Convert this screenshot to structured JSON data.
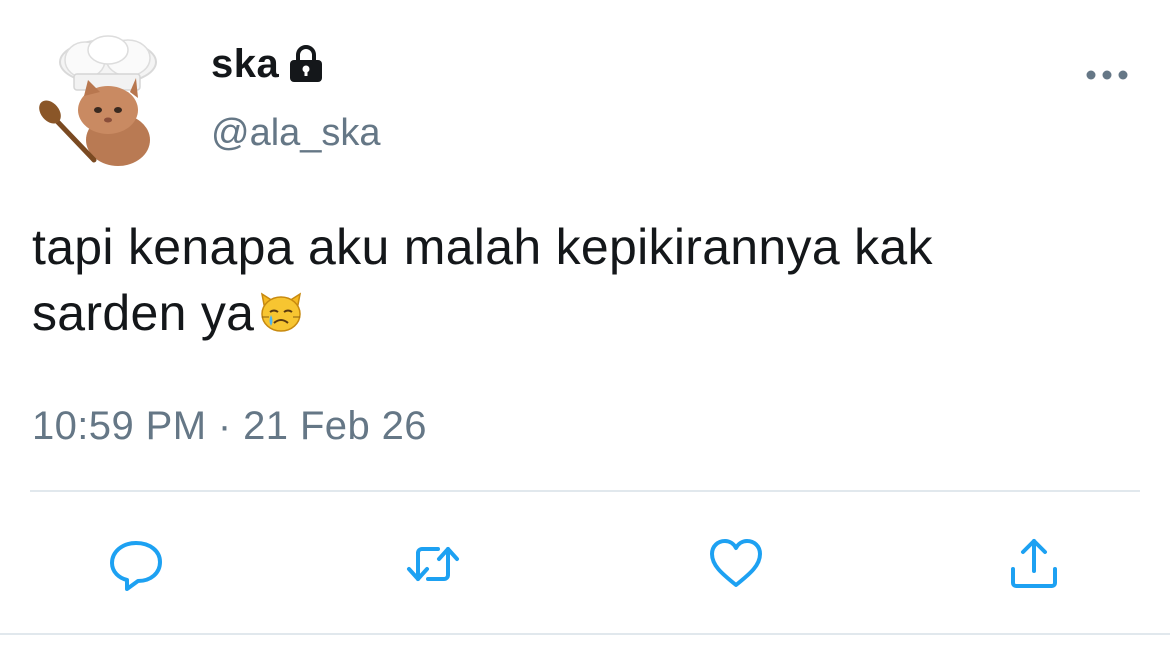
{
  "tweet": {
    "author": {
      "display_name": "ska",
      "handle": "@ala_ska",
      "protected_icon": "lock-icon",
      "avatar": "chef-cat-avatar"
    },
    "text_line1": "tapi kenapa aku malah kepikirannya kak",
    "text_line2": "sarden ya",
    "emoji": "crying-cat-face-emoji",
    "timestamp": "10:59 PM · 21 Feb 26"
  },
  "actions": [
    {
      "name": "reply",
      "icon": "comment-icon"
    },
    {
      "name": "retweet",
      "icon": "retweet-icon"
    },
    {
      "name": "like",
      "icon": "heart-icon"
    },
    {
      "name": "share",
      "icon": "share-icon"
    }
  ],
  "colors": {
    "text": "#14171a",
    "secondary": "#657786",
    "divider": "#e1e8ed",
    "icon": "#1da1f2"
  }
}
